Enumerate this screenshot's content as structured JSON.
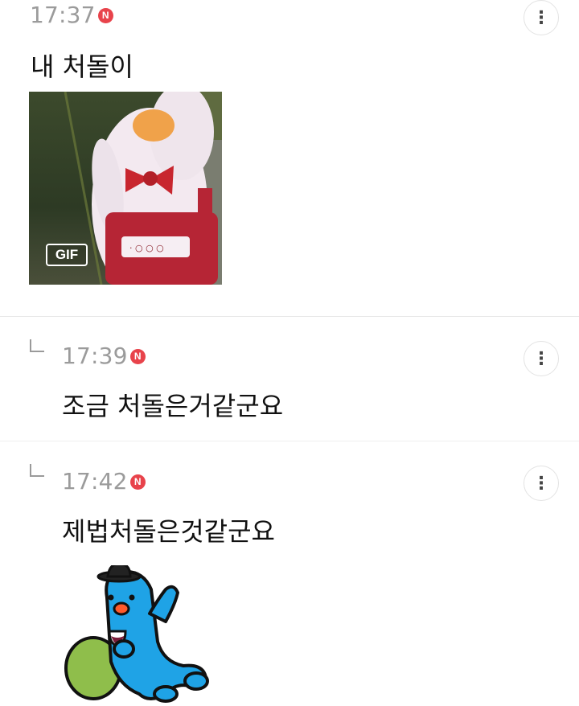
{
  "comments": [
    {
      "time": "17:37",
      "badge": "N",
      "text": "내 처돌이",
      "media": {
        "type": "gif",
        "label": "GIF"
      }
    },
    {
      "time": "17:39",
      "badge": "N",
      "text": "조금 처돌은거같군요"
    },
    {
      "time": "17:42",
      "badge": "N",
      "text": "제법처돌은것같군요",
      "media": {
        "type": "sticker"
      }
    }
  ],
  "icons": {
    "more": "more-vertical-icon",
    "reply": "reply-arrow-icon",
    "new_badge": "new-badge-icon"
  },
  "colors": {
    "time": "#9b9b9b",
    "badge": "#e8434b",
    "divider": "#e6e6e6",
    "sticker_blue": "#1fa3e6"
  }
}
